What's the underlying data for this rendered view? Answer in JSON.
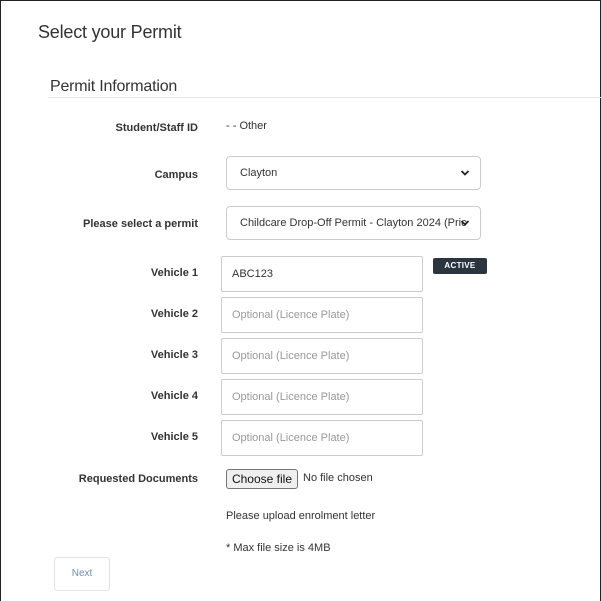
{
  "page": {
    "title": "Select your Permit"
  },
  "section": {
    "title": "Permit Information"
  },
  "fields": {
    "student_id": {
      "label": "Student/Staff ID",
      "value": "- - Other"
    },
    "campus": {
      "label": "Campus",
      "value": "Clayton"
    },
    "permit": {
      "label": "Please select a permit",
      "value": "Childcare Drop-Off Permit - Clayton 2024 (Pric"
    }
  },
  "vehicles": [
    {
      "label": "Vehicle 1",
      "value": "ABC123",
      "placeholder": ""
    },
    {
      "label": "Vehicle 2",
      "value": "",
      "placeholder": "Optional (Licence Plate)"
    },
    {
      "label": "Vehicle 3",
      "value": "",
      "placeholder": "Optional (Licence Plate)"
    },
    {
      "label": "Vehicle 4",
      "value": "",
      "placeholder": "Optional (Licence Plate)"
    },
    {
      "label": "Vehicle 5",
      "value": "",
      "placeholder": "Optional (Licence Plate)"
    }
  ],
  "vehicle1_badge": "ACTIVE",
  "documents": {
    "label": "Requested Documents",
    "choose_label": "Choose file",
    "status": "No file chosen",
    "help1": "Please upload enrolment letter",
    "help2": "* Max file size is 4MB"
  },
  "actions": {
    "next_label": "Next"
  },
  "icons": {
    "select_chevron": "chevron-down-icon"
  },
  "colors": {
    "badge_bg": "#2b3540",
    "next_text": "#6b8fb5",
    "border": "#cccccc"
  }
}
